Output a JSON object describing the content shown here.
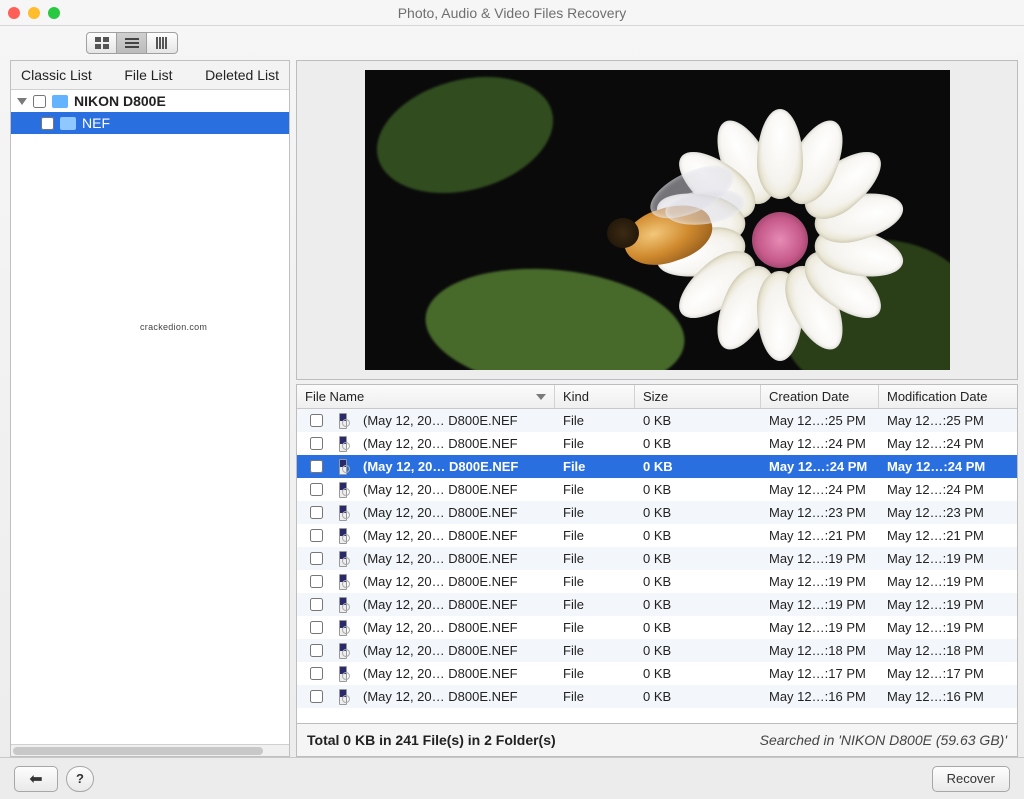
{
  "window": {
    "title": "Photo, Audio & Video Files Recovery"
  },
  "view_modes": {
    "items": [
      "grid-icon",
      "list-icon",
      "columns-icon"
    ],
    "active_index": 1
  },
  "sidebar": {
    "tabs": {
      "classic": "Classic List",
      "file": "File List",
      "deleted": "Deleted List"
    },
    "tree": [
      {
        "label": "NIKON D800E",
        "bold": true,
        "selected": false
      },
      {
        "label": "NEF",
        "bold": false,
        "selected": true
      }
    ],
    "watermark": "crackedion.com"
  },
  "table": {
    "columns": {
      "name": "File Name",
      "kind": "Kind",
      "size": "Size",
      "cdate": "Creation Date",
      "mdate": "Modification Date"
    },
    "rows": [
      {
        "name": "(May 12, 20… D800E.NEF",
        "kind": "File",
        "size": "0 KB",
        "cdate": "May 12…:25 PM",
        "mdate": "May 12…:25 PM",
        "selected": false
      },
      {
        "name": "(May 12, 20… D800E.NEF",
        "kind": "File",
        "size": "0 KB",
        "cdate": "May 12…:24 PM",
        "mdate": "May 12…:24 PM",
        "selected": false
      },
      {
        "name": "(May 12, 20… D800E.NEF",
        "kind": "File",
        "size": "0 KB",
        "cdate": "May 12…:24 PM",
        "mdate": "May 12…:24 PM",
        "selected": true
      },
      {
        "name": "(May 12, 20… D800E.NEF",
        "kind": "File",
        "size": "0 KB",
        "cdate": "May 12…:24 PM",
        "mdate": "May 12…:24 PM",
        "selected": false
      },
      {
        "name": "(May 12, 20… D800E.NEF",
        "kind": "File",
        "size": "0 KB",
        "cdate": "May 12…:23 PM",
        "mdate": "May 12…:23 PM",
        "selected": false
      },
      {
        "name": "(May 12, 20… D800E.NEF",
        "kind": "File",
        "size": "0 KB",
        "cdate": "May 12…:21 PM",
        "mdate": "May 12…:21 PM",
        "selected": false
      },
      {
        "name": "(May 12, 20… D800E.NEF",
        "kind": "File",
        "size": "0 KB",
        "cdate": "May 12…:19 PM",
        "mdate": "May 12…:19 PM",
        "selected": false
      },
      {
        "name": "(May 12, 20… D800E.NEF",
        "kind": "File",
        "size": "0 KB",
        "cdate": "May 12…:19 PM",
        "mdate": "May 12…:19 PM",
        "selected": false
      },
      {
        "name": "(May 12, 20… D800E.NEF",
        "kind": "File",
        "size": "0 KB",
        "cdate": "May 12…:19 PM",
        "mdate": "May 12…:19 PM",
        "selected": false
      },
      {
        "name": "(May 12, 20… D800E.NEF",
        "kind": "File",
        "size": "0 KB",
        "cdate": "May 12…:19 PM",
        "mdate": "May 12…:19 PM",
        "selected": false
      },
      {
        "name": "(May 12, 20… D800E.NEF",
        "kind": "File",
        "size": "0 KB",
        "cdate": "May 12…:18 PM",
        "mdate": "May 12…:18 PM",
        "selected": false
      },
      {
        "name": "(May 12, 20… D800E.NEF",
        "kind": "File",
        "size": "0 KB",
        "cdate": "May 12…:17 PM",
        "mdate": "May 12…:17 PM",
        "selected": false
      },
      {
        "name": "(May 12, 20… D800E.NEF",
        "kind": "File",
        "size": "0 KB",
        "cdate": "May 12…:16 PM",
        "mdate": "May 12…:16 PM",
        "selected": false
      }
    ]
  },
  "summary": {
    "total": "Total 0 KB in 241 File(s) in 2 Folder(s)",
    "searched": "Searched in 'NIKON D800E (59.63 GB)'"
  },
  "footer": {
    "back_glyph": "⬅",
    "help_glyph": "?",
    "recover": "Recover"
  }
}
